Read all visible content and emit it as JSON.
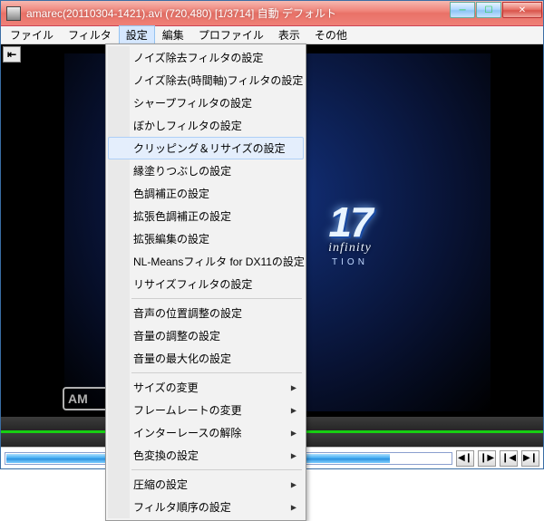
{
  "window": {
    "title": "amarec(20110304-1421).avi (720,480)  [1/3714]  自動  デフォルト"
  },
  "menubar": {
    "items": [
      {
        "label": "ファイル"
      },
      {
        "label": "フィルタ"
      },
      {
        "label": "設定"
      },
      {
        "label": "編集"
      },
      {
        "label": "プロファイル"
      },
      {
        "label": "表示"
      },
      {
        "label": "その他"
      }
    ],
    "open_index": 2
  },
  "dropdown": {
    "highlight_index": 4,
    "items": [
      {
        "label": "ノイズ除去フィルタの設定",
        "sub": false
      },
      {
        "label": "ノイズ除去(時間軸)フィルタの設定",
        "sub": false
      },
      {
        "label": "シャープフィルタの設定",
        "sub": false
      },
      {
        "label": "ぼかしフィルタの設定",
        "sub": false
      },
      {
        "label": "クリッピング＆リサイズの設定",
        "sub": false
      },
      {
        "label": "縁塗りつぶしの設定",
        "sub": false
      },
      {
        "label": "色調補正の設定",
        "sub": false
      },
      {
        "label": "拡張色調補正の設定",
        "sub": false
      },
      {
        "label": "拡張編集の設定",
        "sub": false
      },
      {
        "label": "NL-Meansフィルタ for DX11の設定",
        "sub": false
      },
      {
        "label": "リサイズフィルタの設定",
        "sub": false
      },
      {
        "sep": true
      },
      {
        "label": "音声の位置調整の設定",
        "sub": false
      },
      {
        "label": "音量の調整の設定",
        "sub": false
      },
      {
        "label": "音量の最大化の設定",
        "sub": false
      },
      {
        "sep": true
      },
      {
        "label": "サイズの変更",
        "sub": true
      },
      {
        "label": "フレームレートの変更",
        "sub": true
      },
      {
        "label": "インターレースの解除",
        "sub": true
      },
      {
        "label": "色変換の設定",
        "sub": true
      },
      {
        "sep": true
      },
      {
        "label": "圧縮の設定",
        "sub": true
      },
      {
        "label": "フィルタ順序の設定",
        "sub": true
      }
    ]
  },
  "video": {
    "logo_main": "17",
    "logo_tag": "infinity",
    "logo_sub": "TION",
    "watermark": "AM"
  },
  "progress": {
    "percent": 86
  },
  "winbtn": {
    "min": "─",
    "max": "☐",
    "close": "✕"
  },
  "back_icon": "⇤",
  "ctrl": {
    "prev": "◀❙",
    "next": "❙▶",
    "first": "❙◀",
    "last": "▶❙"
  }
}
